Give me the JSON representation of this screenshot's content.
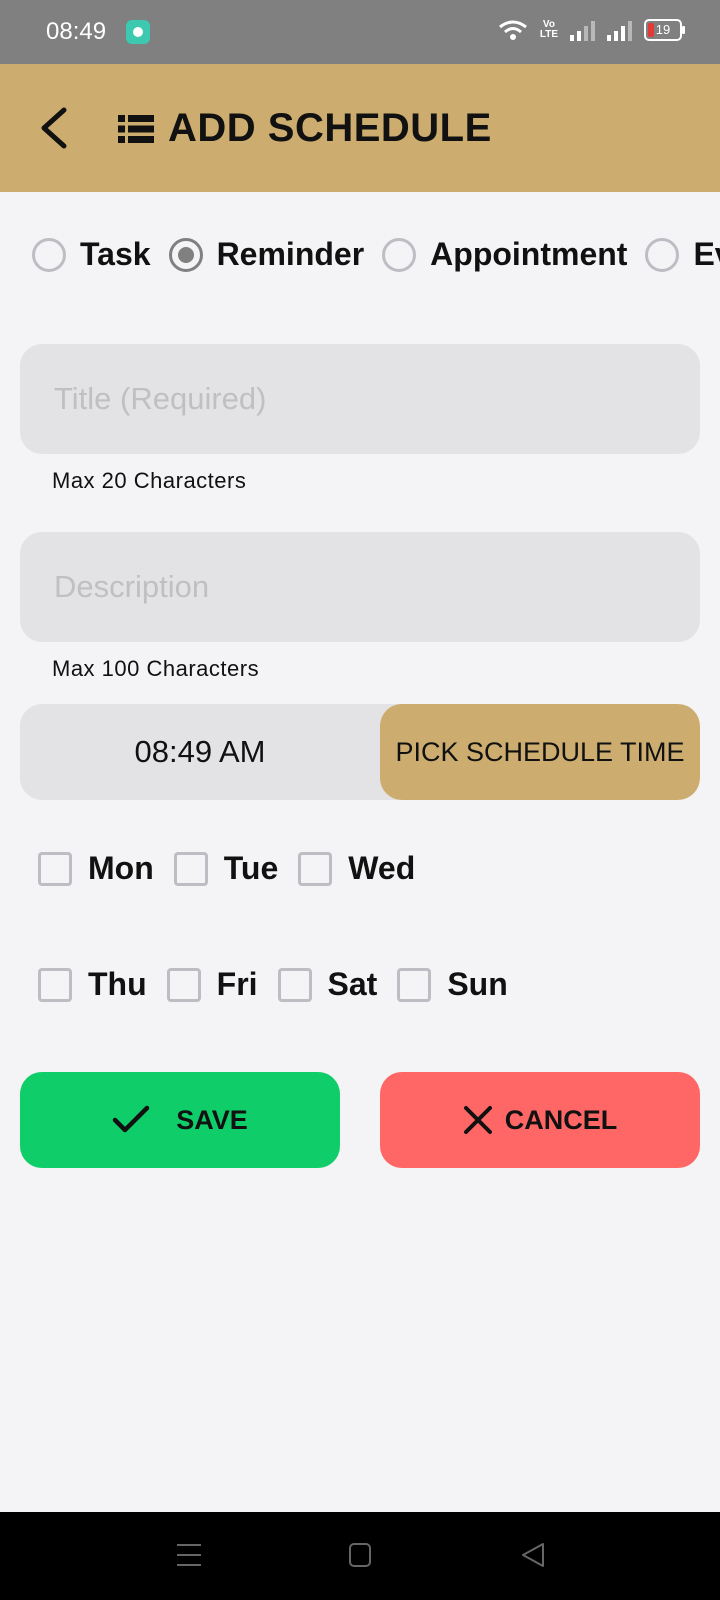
{
  "status_bar": {
    "time": "08:49",
    "battery": "19",
    "volte": "Vo\nLTE"
  },
  "header": {
    "title": "ADD SCHEDULE"
  },
  "schedule_types": [
    {
      "label": "Task",
      "selected": false
    },
    {
      "label": "Reminder",
      "selected": true
    },
    {
      "label": "Appointment",
      "selected": false
    },
    {
      "label": "Ev",
      "selected": false
    }
  ],
  "title_field": {
    "placeholder": "Title (Required)",
    "value": "",
    "hint": "Max 20 Characters"
  },
  "description_field": {
    "placeholder": "Description",
    "value": "",
    "hint": "Max 100 Characters"
  },
  "schedule_time": {
    "value": "08:49 AM",
    "button_label": "PICK SCHEDULE TIME"
  },
  "days_row1": [
    "Mon",
    "Tue",
    "Wed"
  ],
  "days_row2": [
    "Thu",
    "Fri",
    "Sat",
    "Sun"
  ],
  "actions": {
    "save_label": "SAVE",
    "cancel_label": "CANCEL"
  },
  "colors": {
    "header": "#ccad6f",
    "save": "#0fce6a",
    "cancel": "#ff6666",
    "status_bar": "#808080"
  }
}
